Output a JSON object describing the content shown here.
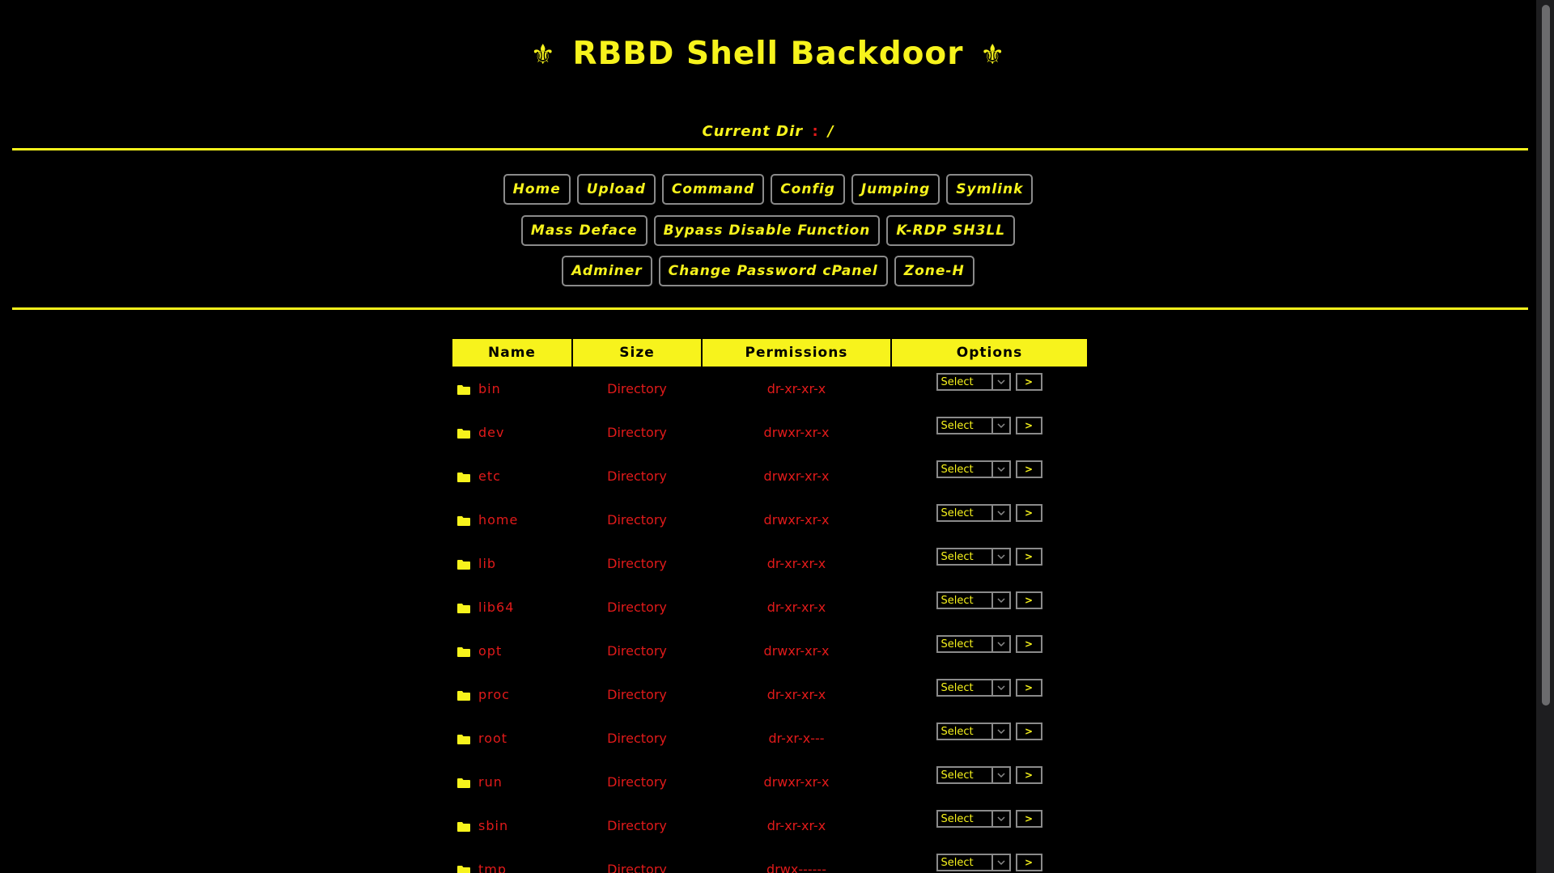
{
  "page": {
    "title": "RBBD Shell Backdoor",
    "title_deco": "⚜",
    "current_dir_label": "Current Dir",
    "current_dir_sep": ":",
    "current_dir_path": "/"
  },
  "nav": {
    "row1": [
      "Home",
      "Upload",
      "Command",
      "Config",
      "Jumping",
      "Symlink"
    ],
    "row2": [
      "Mass Deface",
      "Bypass Disable Function",
      "K-RDP SH3LL"
    ],
    "row3": [
      "Adminer",
      "Change Password cPanel",
      "Zone-H"
    ]
  },
  "table": {
    "headers": [
      "Name",
      "Size",
      "Permissions",
      "Options"
    ],
    "select_label": "Select",
    "go_label": ">",
    "rows": [
      {
        "name": "bin",
        "size": "Directory",
        "perm": "dr-xr-xr-x"
      },
      {
        "name": "dev",
        "size": "Directory",
        "perm": "drwxr-xr-x"
      },
      {
        "name": "etc",
        "size": "Directory",
        "perm": "drwxr-xr-x"
      },
      {
        "name": "home",
        "size": "Directory",
        "perm": "drwxr-xr-x"
      },
      {
        "name": "lib",
        "size": "Directory",
        "perm": "dr-xr-xr-x"
      },
      {
        "name": "lib64",
        "size": "Directory",
        "perm": "dr-xr-xr-x"
      },
      {
        "name": "opt",
        "size": "Directory",
        "perm": "drwxr-xr-x"
      },
      {
        "name": "proc",
        "size": "Directory",
        "perm": "dr-xr-xr-x"
      },
      {
        "name": "root",
        "size": "Directory",
        "perm": "dr-xr-x---"
      },
      {
        "name": "run",
        "size": "Directory",
        "perm": "drwxr-xr-x"
      },
      {
        "name": "sbin",
        "size": "Directory",
        "perm": "dr-xr-xr-x"
      },
      {
        "name": "tmp",
        "size": "Directory",
        "perm": "drwx------"
      }
    ]
  },
  "colors": {
    "accent": "#f7f31c",
    "file_text": "#e11a1a",
    "background": "#000000"
  },
  "icons": {
    "folder": "folder-icon",
    "dropdown": "chevron-down-icon"
  }
}
